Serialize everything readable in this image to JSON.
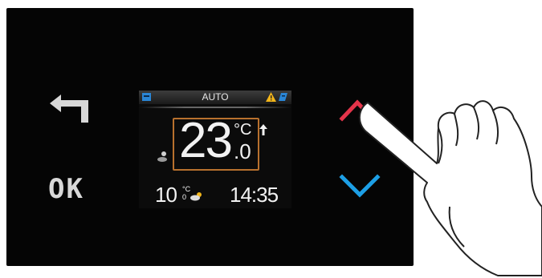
{
  "colors": {
    "panel": "#050505",
    "temp_frame": "#b8712e",
    "up_arrow": "#e4344a",
    "down_arrow": "#1d9fe6",
    "warning": "#f2b51a",
    "status_icon_blue": "#2a86d6"
  },
  "buttons": {
    "back_icon": "back-arrow-icon",
    "ok_label": "OK",
    "up_icon": "chevron-up-icon",
    "down_icon": "chevron-down-icon"
  },
  "screen": {
    "mode": "AUTO",
    "temperature": {
      "integer": "23",
      "unit": "°C",
      "decimal": ".0"
    },
    "outdoor": {
      "value": "10",
      "unit_small": "°C",
      "decimal_small": "0"
    },
    "time": "14:35",
    "icons": [
      "status-icon",
      "warning-icon",
      "flag-icon",
      "arrow-up-icon",
      "person-icon",
      "cloud-icon"
    ]
  }
}
